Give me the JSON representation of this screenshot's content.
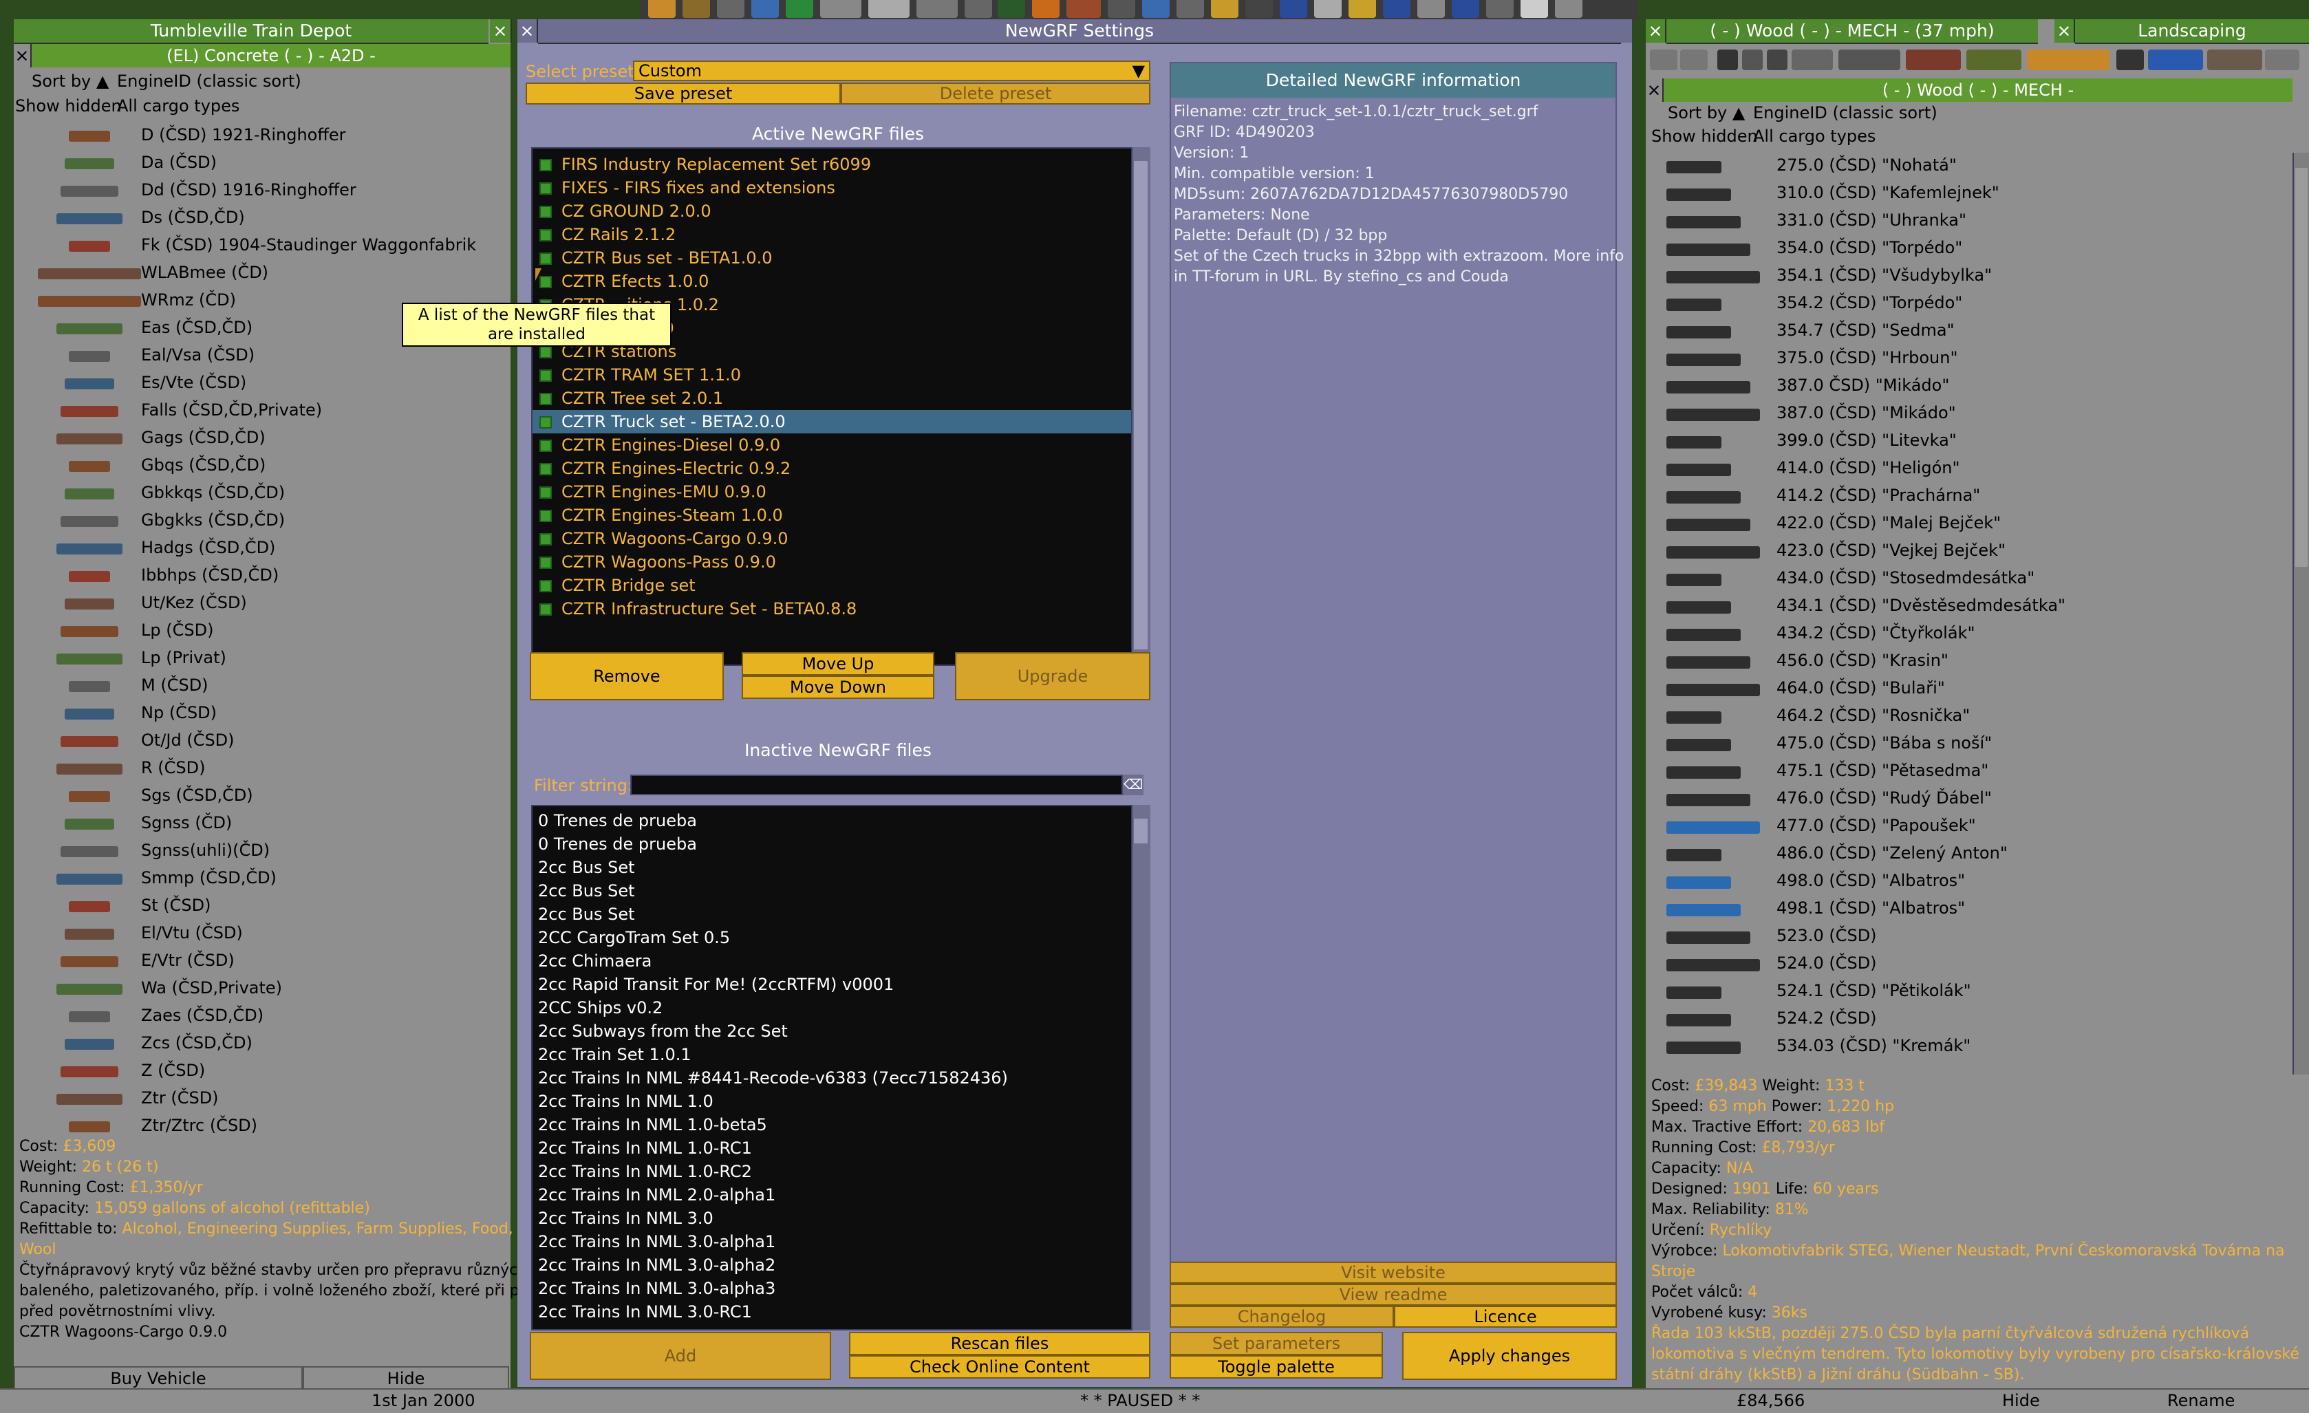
{
  "depot": {
    "title": "Tumbleville Train Depot",
    "subtitle": "(EL) Concrete ( - ) - A2D -",
    "sort_label": "Sort by",
    "sort_value": "EngineID (classic sort)",
    "filter_label": "Show hidden",
    "cargo_filter": "All cargo types",
    "vehicles": [
      "D (ČSD) 1921-Ringhoffer",
      "Da (ČSD)",
      "Dd (ČSD) 1916-Ringhoffer",
      "Ds (ČSD,ČD)",
      "Fk (ČSD) 1904-Staudinger Waggonfabrik",
      "WLABmee (ČD)",
      "WRmz (ČD)",
      "Eas (ČSD,ČD)",
      "Eal/Vsa (ČSD)",
      "Es/Vte (ČSD)",
      "Falls (ČSD,ČD,Private)",
      "Gags (ČSD,ČD)",
      "Gbqs (ČSD,ČD)",
      "Gbkkqs (ČSD,ČD)",
      "Gbgkks (ČSD,ČD)",
      "Hadgs (ČSD,ČD)",
      "Ibbhps (ČSD,ČD)",
      "Ut/Kez (ČSD)",
      "Lp (ČSD)",
      "Lp (Privat)",
      "M (ČSD)",
      "Np (ČSD)",
      "Ot/Jd (ČSD)",
      "R (ČSD)",
      "Sgs (ČSD,ČD)",
      "Sgnss (ČD)",
      "Sgnss(uhli)(ČD)",
      "Smmp (ČSD,ČD)",
      "St (ČSD)",
      "El/Vtu (ČSD)",
      "E/Vtr (ČSD)",
      "Wa (ČSD,Private)",
      "Zaes (ČSD,ČD)",
      "Zcs (ČSD,ČD)",
      "Z (ČSD)",
      "Ztr (ČSD)",
      "Ztr/Ztrc (ČSD)"
    ],
    "details": {
      "cost_label": "Cost:",
      "cost_value": "£3,609",
      "weight_label": "Weight:",
      "weight_value": "26 t (26 t)",
      "running_label": "Running Cost:",
      "running_value": "£1,350/yr",
      "capacity_label": "Capacity:",
      "capacity_value": "15,059 gallons of alcohol (refittable)",
      "refit_label": "Refittable to:",
      "refit_value": "Alcohol, Engineering Supplies, Farm Supplies, Food, F",
      "refit_value2": "Wool",
      "desc1": "Čtyřnápravový krytý vůz běžné stavby určen pro přepravu různých",
      "desc2": "baleného, paletizovaného, příp. i volně loženého zboží, které při pře",
      "desc3": "před povětrnostními vlivy.",
      "source": "CZTR Wagoons-Cargo 0.9.0"
    },
    "buy_button": "Buy Vehicle",
    "hide_button": "Hide"
  },
  "newgrf": {
    "title": "NewGRF Settings",
    "preset_label": "Select preset:",
    "preset_value": "Custom",
    "save_preset": "Save preset",
    "delete_preset": "Delete preset",
    "active_header": "Active NewGRF files",
    "active": [
      "FIRS Industry Replacement Set r6099",
      "FIXES - FIRS fixes and extensions",
      "CZ GROUND 2.0.0",
      "CZ Rails 2.1.2",
      "CZTR Bus set - BETA1.0.0",
      "CZTR Efects 1.0.0",
      "CZTR ...itions 1.0.2",
      "CZTR ... 2.0.0",
      "CZTR stations",
      "CZTR TRAM SET 1.1.0",
      "CZTR Tree set 2.0.1",
      "CZTR Truck set - BETA2.0.0",
      "CZTR Engines-Diesel 0.9.0",
      "CZTR Engines-Electric 0.9.2",
      "CZTR Engines-EMU 0.9.0",
      "CZTR Engines-Steam 1.0.0",
      "CZTR Wagoons-Cargo 0.9.0",
      "CZTR Wagoons-Pass 0.9.0",
      "CZTR Bridge set",
      "CZTR Infrastructure Set - BETA0.8.8"
    ],
    "selected_index": 11,
    "tooltip": "A list of the NewGRF files that are installed",
    "remove": "Remove",
    "move_up": "Move Up",
    "move_down": "Move Down",
    "upgrade": "Upgrade",
    "inactive_header": "Inactive NewGRF files",
    "filter_label": "Filter string:",
    "inactive": [
      "0 Trenes de prueba",
      "0 Trenes de prueba",
      "2cc Bus Set",
      "2cc Bus Set",
      "2cc Bus Set",
      "2CC CargoTram Set 0.5",
      "2cc Chimaera",
      "2cc Rapid Transit For Me! (2ccRTFM) v0001",
      "2CC Ships v0.2",
      "2cc Subways from the 2cc Set",
      "2cc Train Set 1.0.1",
      "2cc Trains In NML #8441-Recode-v6383 (7ecc71582436)",
      "2cc Trains In NML 1.0",
      "2cc Trains In NML 1.0-beta5",
      "2cc Trains In NML 1.0-RC1",
      "2cc Trains In NML 1.0-RC2",
      "2cc Trains In NML 2.0-alpha1",
      "2cc Trains In NML 3.0",
      "2cc Trains In NML 3.0-alpha1",
      "2cc Trains In NML 3.0-alpha2",
      "2cc Trains In NML 3.0-alpha3",
      "2cc Trains In NML 3.0-RC1"
    ],
    "add": "Add",
    "rescan": "Rescan files",
    "check_online": "Check Online Content",
    "info_header": "Detailed NewGRF information",
    "info": [
      "Filename: cztr_truck_set-1.0.1/cztr_truck_set.grf",
      "GRF ID: 4D490203",
      "Version: 1",
      "Min. compatible version: 1",
      "MD5sum: 2607A762DA7D12DA45776307980D5790",
      "Parameters: None",
      "Palette: Default (D) / 32 bpp",
      "Set of the Czech trucks in 32bpp with extrazoom. More info",
      "in TT-forum in URL. By stefino_cs and Couda"
    ],
    "visit_website": "Visit website",
    "view_readme": "View readme",
    "changelog": "Changelog",
    "licence": "Licence",
    "set_parameters": "Set parameters",
    "toggle_palette": "Toggle palette",
    "apply_changes": "Apply changes"
  },
  "engines": {
    "title": "( - ) Wood ( - ) - MECH - (37 mph)",
    "landscaping": "Landscaping",
    "subtitle": "( - ) Wood ( - ) - MECH -",
    "sort_label": "Sort by",
    "sort_value": "EngineID (classic sort)",
    "filter_label": "Show hidden",
    "cargo_filter": "All cargo types",
    "list": [
      "275.0 (ČSD) \"Nohatá\"",
      "310.0 (ČSD) \"Kafemlejnek\"",
      "331.0 (ČSD) \"Uhranka\"",
      "354.0 (ČSD) \"Torpédo\"",
      "354.1 (ČSD) \"Všudybylka\"",
      "354.2 (ČSD) \"Torpédo\"",
      "354.7 (ČSD) \"Sedma\"",
      "375.0 (ČSD) \"Hrboun\"",
      "387.0 ČSD) \"Mikádo\"",
      "387.0 (ČSD) \"Mikádo\"",
      "399.0 (ČSD) \"Litevka\"",
      "414.0 (ČSD) \"Heligón\"",
      "414.2 (ČSD) \"Prachárna\"",
      "422.0 (ČSD) \"Malej Bejček\"",
      "423.0 (ČSD) \"Vejkej Bejček\"",
      "434.0 (ČSD) \"Stosedmdesátka\"",
      "434.1 (ČSD) \"Dvěstěsedmdesátka\"",
      "434.2 (ČSD) \"Čtyřkolák\"",
      "456.0 (ČSD) \"Krasin\"",
      "464.0 (ČSD) \"Bulaři\"",
      "464.2 (ČSD) \"Rosnička\"",
      "475.0 (ČSD) \"Bába s noší\"",
      "475.1 (ČSD) \"Pětasedma\"",
      "476.0 (ČSD) \"Rudý Ďábel\"",
      "477.0 (ČSD) \"Papoušek\"",
      "486.0 (ČSD) \"Zelený Anton\"",
      "498.0 (ČSD) \"Albatros\"",
      "498.1 (ČSD) \"Albatros\"",
      "523.0 (ČSD)",
      "524.0 (ČSD)",
      "524.1 (ČSD) \"Pětikolák\"",
      "524.2 (ČSD)",
      "534.03 (ČSD) \"Kremák\""
    ],
    "details": [
      [
        "Cost: ",
        "£39,843",
        " Weight: ",
        "133 t"
      ],
      [
        "Speed: ",
        "63 mph",
        " Power: ",
        "1,220 hp"
      ],
      [
        "Max. Tractive Effort: ",
        "20,683 lbf",
        "",
        ""
      ],
      [
        "Running Cost: ",
        "£8,793/yr",
        "",
        ""
      ],
      [
        "Capacity: ",
        "N/A",
        "",
        ""
      ],
      [
        "Designed: ",
        "1901",
        " Life: ",
        "60 years"
      ],
      [
        "Max. Reliability: ",
        "81%",
        "",
        ""
      ],
      [
        "Určení: ",
        "Rychlíky",
        "",
        ""
      ],
      [
        "Výrobce: ",
        "Lokomotivfabrik STEG, Wiener Neustadt, První Českomoravská Továrna na",
        "",
        ""
      ],
      [
        "",
        "Stroje",
        "",
        ""
      ],
      [
        "Počet válců: ",
        "4",
        "",
        ""
      ],
      [
        "Vyrobené kusy: ",
        "36ks",
        "",
        ""
      ]
    ],
    "desc1": "Řada 103 kkStB, později 275.0 ČSD byla parní čtyřválcová sdružená rychlíková",
    "desc2": "lokomotiva s vlečným tendrem. Tyto lokomotivy byly vyrobeny pro císařsko-královské",
    "desc3": "státní dráhy (kkStB) a Jižní dráhu (Südbahn - SB).",
    "source": "CZTR Engines-Steam 1.0.0",
    "hide": "Hide",
    "rename": "Rename"
  },
  "status": {
    "date": "1st Jan 2000",
    "paused": "* * PAUSED * *",
    "money": "£84,566"
  }
}
